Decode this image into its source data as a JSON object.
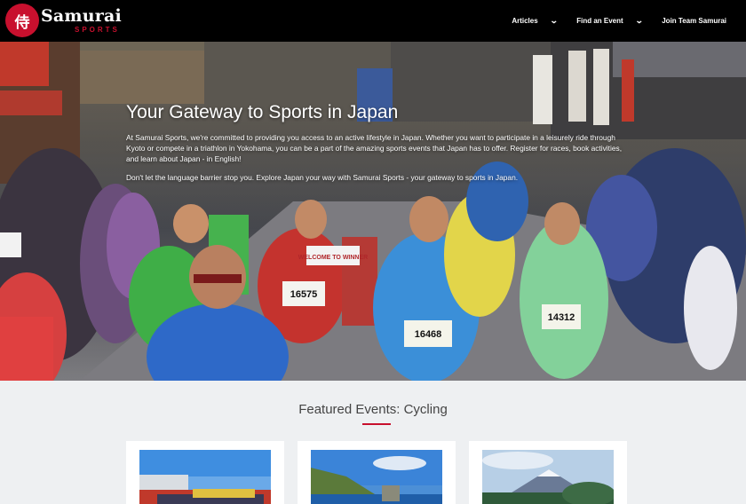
{
  "header": {
    "brand": "Samurai",
    "brand_sub": "SPORTS",
    "logo_glyph": "侍",
    "nav": [
      {
        "label": "Articles",
        "has_dropdown": true
      },
      {
        "label": "Find an Event",
        "has_dropdown": true
      },
      {
        "label": "Join Team Samurai",
        "has_dropdown": false
      }
    ]
  },
  "hero": {
    "title": "Your Gateway to Sports in Japan",
    "paragraph1": "At Samurai Sports, we're committed to providing you access to an active lifestyle in Japan. Whether you want to participate in a leisurely ride through Kyoto or compete in a triathlon in Yokohama, you can be a part of the amazing sports events that Japan has to offer. Register for races, book activities, and learn about Japan - in English!",
    "paragraph2": "Don't let the language barrier stop you. Explore Japan your way with Samurai Sports - your gateway to sports in Japan.",
    "bibs": [
      "16575",
      "16468",
      "14312"
    ],
    "banner_text": "WELCOME TO WINNER"
  },
  "featured": {
    "title": "Featured Events: Cycling"
  },
  "colors": {
    "accent": "#c8102e",
    "nav_bg": "#000000",
    "section_bg": "#eef0f2"
  }
}
